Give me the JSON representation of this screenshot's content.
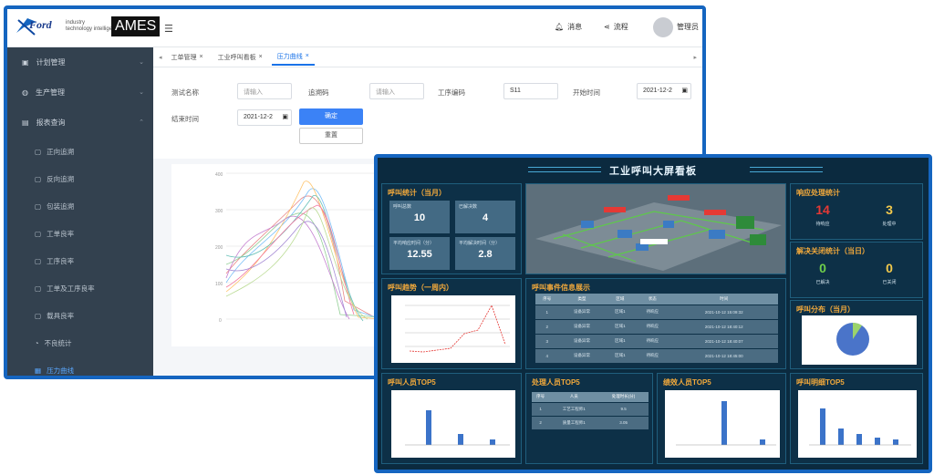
{
  "app": {
    "logo_text": "Ford",
    "logo_sub1": "industry",
    "logo_sub2": "technology intelligence",
    "brand": "AMES"
  },
  "header": {
    "messages": "消息",
    "flow": "流程",
    "user": "管理员"
  },
  "sidebar": {
    "items": [
      {
        "label": "计划管理",
        "icon": "calendar-icon"
      },
      {
        "label": "生产管理",
        "icon": "production-icon"
      },
      {
        "label": "报表查询",
        "icon": "report-icon"
      }
    ],
    "subitems": [
      "正向追溯",
      "反向追溯",
      "包装追溯",
      "工单良率",
      "工序良率",
      "工单及工序良率",
      "载具良率",
      "不良统计",
      "压力曲线"
    ]
  },
  "tabs": [
    "工单管理",
    "工业呼叫看板",
    "压力曲线"
  ],
  "form": {
    "test_name_label": "测试名称",
    "test_name_placeholder": "请输入",
    "sn_label": "追溯码",
    "sn_placeholder": "请输入",
    "station_label": "工序编码",
    "station_value": "S11",
    "start_label": "开始时间",
    "start_value": "2021-12-2",
    "end_label": "结束时间",
    "end_value": "2021-12-2",
    "query_btn": "确定",
    "reset_btn": "重置"
  },
  "chart1_axis": [
    "400",
    "300",
    "200",
    "100",
    "0"
  ],
  "dashboard": {
    "title": "工业呼叫大屏看板",
    "call_stats": {
      "title": "呼叫统计（当月）",
      "items": [
        {
          "label": "呼叫总数",
          "value": "10"
        },
        {
          "label": "已解决数",
          "value": "4"
        },
        {
          "label": "平均响应时间（分）",
          "value": "12.55"
        },
        {
          "label": "平均解决时间（分）",
          "value": "2.8"
        }
      ]
    },
    "response": {
      "title": "响应处理统计",
      "pending": "14",
      "pending_label": "待响应",
      "processing": "3",
      "processing_label": "处理中"
    },
    "close": {
      "title": "解决关闭统计（当日）",
      "resolved": "0",
      "resolved_label": "已解决",
      "closed": "0",
      "closed_label": "已关闭"
    },
    "dist": {
      "title": "呼叫分布（当月）"
    },
    "trend": {
      "title": "呼叫趋势（一周内）"
    },
    "events": {
      "title": "呼叫事件信息展示",
      "headers": [
        "序号",
        "类型",
        "区域",
        "状态",
        "时间"
      ],
      "rows": [
        [
          "1",
          "设备异常",
          "区域1",
          "待响应",
          "2021-10-12 15:09:32"
        ],
        [
          "2",
          "设备异常",
          "区域1",
          "待响应",
          "2021-10-12 18:40:12"
        ],
        [
          "3",
          "设备异常",
          "区域1",
          "待响应",
          "2021-10-12 18:40:07"
        ],
        [
          "4",
          "设备异常",
          "区域1",
          "待响应",
          "2021-10-12 18:45:00"
        ]
      ]
    },
    "top_callers": {
      "title": "呼叫人员TOP5"
    },
    "top_handlers": {
      "title": "处理人员TOP5",
      "headers": [
        "序号",
        "人员",
        "处理时长(分)"
      ],
      "rows": [
        [
          "1",
          "工艺工程师1",
          "9.5"
        ],
        [
          "2",
          "质量工程师1",
          "3.05"
        ]
      ]
    },
    "top_perf": {
      "title": "绩效人员TOP5"
    },
    "top_detail": {
      "title": "呼叫明细TOP5"
    }
  },
  "colors": {
    "border": "#1565c0",
    "dash_bg": "#0b2a3f",
    "accent_orange": "#f2a93b",
    "accent_red": "#e53935",
    "accent_yellow": "#f2c94c",
    "accent_green": "#6fcf4b"
  }
}
